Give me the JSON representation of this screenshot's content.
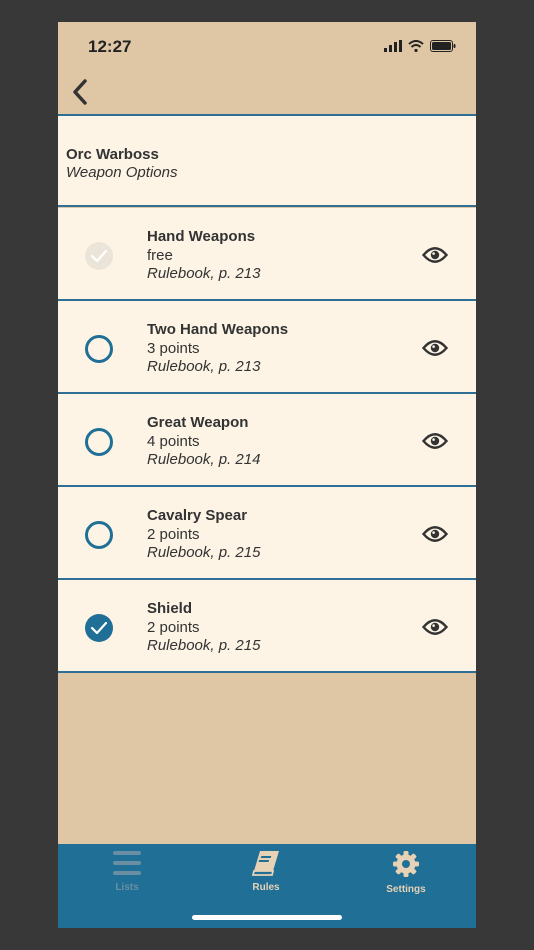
{
  "status_bar": {
    "time": "12:27"
  },
  "header": {
    "title": "Orc Warboss",
    "subtitle": "Weapon Options"
  },
  "options": [
    {
      "name": "Hand Weapons",
      "cost": "free",
      "reference": "Rulebook, p. 213",
      "state": "disabled-checked"
    },
    {
      "name": "Two Hand Weapons",
      "cost": "3 points",
      "reference": "Rulebook, p. 213",
      "state": "unchecked"
    },
    {
      "name": "Great Weapon",
      "cost": "4 points",
      "reference": "Rulebook, p. 214",
      "state": "unchecked"
    },
    {
      "name": "Cavalry Spear",
      "cost": "2 points",
      "reference": "Rulebook, p. 215",
      "state": "unchecked"
    },
    {
      "name": "Shield",
      "cost": "2 points",
      "reference": "Rulebook, p. 215",
      "state": "checked"
    }
  ],
  "tabbar": {
    "tabs": [
      {
        "label": "Lists",
        "icon": "hamburger-icon",
        "active": false
      },
      {
        "label": "Rules",
        "icon": "book-icon",
        "active": true
      },
      {
        "label": "Settings",
        "icon": "gear-icon",
        "active": true
      }
    ]
  },
  "colors": {
    "background": "#dfc7a6",
    "card": "#fdf4e6",
    "accent": "#1f6f96",
    "tab_inactive": "#6a8ea3",
    "tab_active": "#e7d2b6"
  }
}
